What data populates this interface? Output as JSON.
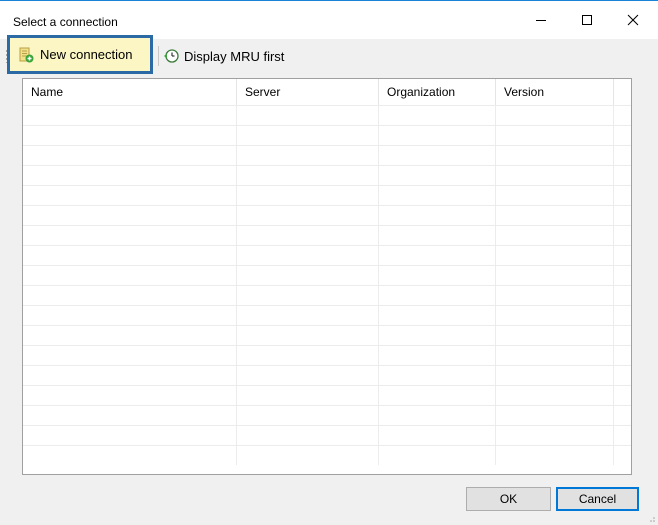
{
  "window": {
    "title": "Select a connection",
    "controls": {
      "minimize": "minimize-icon",
      "maximize": "maximize-icon",
      "close": "close-icon"
    }
  },
  "toolbar": {
    "new_connection_label": "New connection",
    "new_connection_icon": "database-add-icon",
    "display_mru_label": "Display MRU first",
    "display_mru_icon": "history-clock-icon"
  },
  "grid": {
    "columns": [
      "Name",
      "Server",
      "Organization",
      "Version"
    ],
    "rows": []
  },
  "footer": {
    "ok_label": "OK",
    "cancel_label": "Cancel"
  },
  "colors": {
    "highlight_border": "#2c6aa5",
    "highlight_fill": "#fbf6c4",
    "accent": "#0078d7"
  }
}
